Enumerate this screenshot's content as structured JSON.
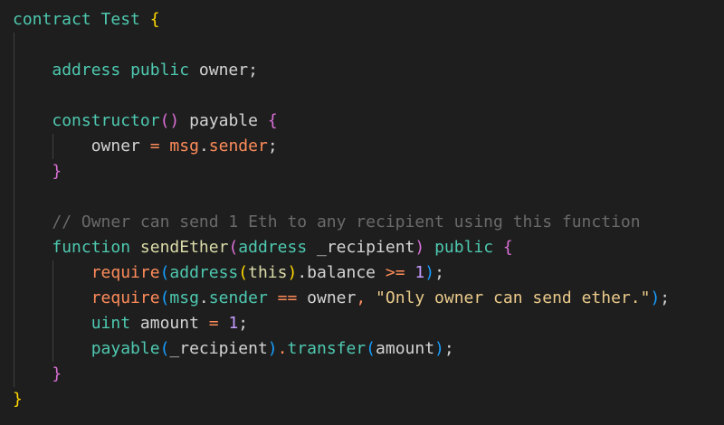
{
  "editor": {
    "language": "solidity",
    "theme": "dark",
    "colors": {
      "background": "#1e1e1e",
      "keyword": "#4ec9b0",
      "function_name": "#dcdcaa",
      "plain": "#d4d4d4",
      "operator": "#ff8c5a",
      "brace_gold": "#ffd700",
      "brace_pink": "#da70d6",
      "brace_blue": "#179fff",
      "string": "#ebcb8b",
      "number": "#c39bff",
      "comment": "#6a6a6a",
      "indent_guide": "#404040"
    },
    "lines": [
      {
        "indent": 0,
        "tokens": [
          {
            "text": "contract ",
            "color": "#4ec9b0"
          },
          {
            "text": "Test ",
            "color": "#4ec9b0"
          },
          {
            "text": "{",
            "color": "#ffd700"
          }
        ]
      },
      {
        "indent": 0,
        "tokens": []
      },
      {
        "indent": 1,
        "tokens": [
          {
            "text": "address ",
            "color": "#4ec9b0"
          },
          {
            "text": "public ",
            "color": "#4ec9b0"
          },
          {
            "text": "owner;",
            "color": "#d4d4d4"
          }
        ]
      },
      {
        "indent": 0,
        "tokens": []
      },
      {
        "indent": 1,
        "tokens": [
          {
            "text": "constructor",
            "color": "#4ec9b0"
          },
          {
            "text": "()",
            "color": "#da70d6"
          },
          {
            "text": " payable ",
            "color": "#d4d4d4"
          },
          {
            "text": "{",
            "color": "#da70d6"
          }
        ]
      },
      {
        "indent": 2,
        "tokens": [
          {
            "text": "owner ",
            "color": "#d4d4d4"
          },
          {
            "text": "= ",
            "color": "#ff8c5a"
          },
          {
            "text": "msg",
            "color": "#ff8c5a"
          },
          {
            "text": ".",
            "color": "#d4d4d4"
          },
          {
            "text": "sender",
            "color": "#ff8c5a"
          },
          {
            "text": ";",
            "color": "#d4d4d4"
          }
        ]
      },
      {
        "indent": 1,
        "tokens": [
          {
            "text": "}",
            "color": "#da70d6"
          }
        ]
      },
      {
        "indent": 0,
        "tokens": []
      },
      {
        "indent": 1,
        "tokens": [
          {
            "text": "// Owner can send 1 Eth to any recipient using this function",
            "color": "#6a6a6a"
          }
        ]
      },
      {
        "indent": 1,
        "tokens": [
          {
            "text": "function ",
            "color": "#4ec9b0"
          },
          {
            "text": "sendEther",
            "color": "#dcdcaa"
          },
          {
            "text": "(",
            "color": "#da70d6"
          },
          {
            "text": "address ",
            "color": "#4ec9b0"
          },
          {
            "text": "_recipient",
            "color": "#d4d4d4"
          },
          {
            "text": ") ",
            "color": "#da70d6"
          },
          {
            "text": "public ",
            "color": "#4ec9b0"
          },
          {
            "text": "{",
            "color": "#da70d6"
          }
        ]
      },
      {
        "indent": 2,
        "tokens": [
          {
            "text": "require",
            "color": "#ff8c5a"
          },
          {
            "text": "(",
            "color": "#179fff"
          },
          {
            "text": "address",
            "color": "#4ec9b0"
          },
          {
            "text": "(",
            "color": "#ffd700"
          },
          {
            "text": "this",
            "color": "#dcdcaa"
          },
          {
            "text": ")",
            "color": "#ffd700"
          },
          {
            "text": ".",
            "color": "#d4d4d4"
          },
          {
            "text": "balance ",
            "color": "#d4d4d4"
          },
          {
            "text": ">= ",
            "color": "#ff8c5a"
          },
          {
            "text": "1",
            "color": "#c39bff"
          },
          {
            "text": ")",
            "color": "#179fff"
          },
          {
            "text": ";",
            "color": "#d4d4d4"
          }
        ]
      },
      {
        "indent": 2,
        "tokens": [
          {
            "text": "require",
            "color": "#ff8c5a"
          },
          {
            "text": "(",
            "color": "#179fff"
          },
          {
            "text": "msg",
            "color": "#4ec9b0"
          },
          {
            "text": ".",
            "color": "#d4d4d4"
          },
          {
            "text": "sender ",
            "color": "#4ec9b0"
          },
          {
            "text": "== ",
            "color": "#ff8c5a"
          },
          {
            "text": "owner",
            "color": "#d4d4d4"
          },
          {
            "text": ", ",
            "color": "#ff8c5a"
          },
          {
            "text": "\"Only owner can send ether.\"",
            "color": "#ebcb8b"
          },
          {
            "text": ")",
            "color": "#179fff"
          },
          {
            "text": ";",
            "color": "#d4d4d4"
          }
        ]
      },
      {
        "indent": 2,
        "tokens": [
          {
            "text": "uint ",
            "color": "#4ec9b0"
          },
          {
            "text": "amount ",
            "color": "#d4d4d4"
          },
          {
            "text": "= ",
            "color": "#ff8c5a"
          },
          {
            "text": "1",
            "color": "#c39bff"
          },
          {
            "text": ";",
            "color": "#d4d4d4"
          }
        ]
      },
      {
        "indent": 2,
        "tokens": [
          {
            "text": "payable",
            "color": "#4ec9b0"
          },
          {
            "text": "(",
            "color": "#179fff"
          },
          {
            "text": "_recipient",
            "color": "#d4d4d4"
          },
          {
            "text": ")",
            "color": "#179fff"
          },
          {
            "text": ".",
            "color": "#ff8c5a"
          },
          {
            "text": "transfer",
            "color": "#4ec9b0"
          },
          {
            "text": "(",
            "color": "#179fff"
          },
          {
            "text": "amount",
            "color": "#d4d4d4"
          },
          {
            "text": ")",
            "color": "#179fff"
          },
          {
            "text": ";",
            "color": "#d4d4d4"
          }
        ]
      },
      {
        "indent": 1,
        "tokens": [
          {
            "text": "}",
            "color": "#da70d6"
          }
        ]
      },
      {
        "indent": 0,
        "tokens": [
          {
            "text": "}",
            "color": "#ffd700"
          }
        ]
      }
    ]
  }
}
